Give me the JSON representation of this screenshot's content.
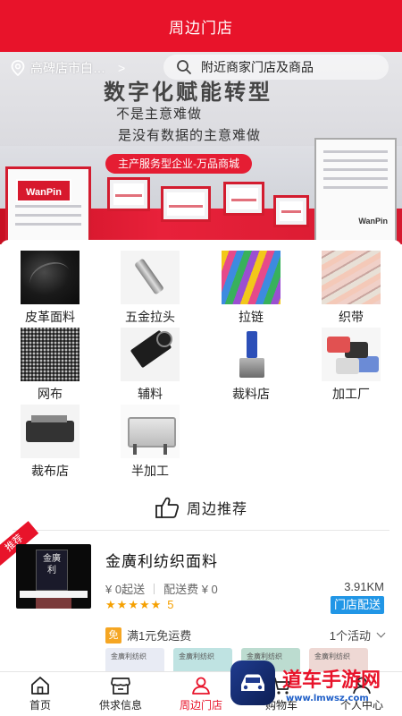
{
  "header": {
    "title": "周边门店"
  },
  "location": {
    "text": "高碑店市白…"
  },
  "search": {
    "placeholder": "附近商家门店及商品"
  },
  "banner": {
    "headline": "数字化赋能转型",
    "line1": "不是主意难做",
    "line2": "是没有数据的主意难做",
    "pill": "主产服务型企业-万品商城",
    "logo": "WanPin",
    "logo_small": "WanPin"
  },
  "categories": [
    {
      "label": "皮革面料",
      "icon": "leather-fabric-image"
    },
    {
      "label": "五金拉头",
      "icon": "zipper-head-image"
    },
    {
      "label": "拉链",
      "icon": "zipper-image"
    },
    {
      "label": "织带",
      "icon": "webbing-image"
    },
    {
      "label": "网布",
      "icon": "mesh-fabric-image"
    },
    {
      "label": "辅料",
      "icon": "accessories-image"
    },
    {
      "label": "裁料店",
      "icon": "cutting-shop-image"
    },
    {
      "label": "加工厂",
      "icon": "factory-image"
    },
    {
      "label": "裁布店",
      "icon": "cloth-cutting-image"
    },
    {
      "label": "半加工",
      "icon": "semi-processing-image"
    }
  ],
  "recommend": {
    "title": "周边推荐",
    "icon": "thumbs-up-icon"
  },
  "store": {
    "ribbon": "推荐",
    "thumb_text": "金廣利",
    "name": "金廣利纺织面料",
    "min_order": "¥ 0起送",
    "delivery_fee": "配送费 ¥ 0",
    "distance": "3.91KM",
    "rating": "5",
    "rating_stars": 5,
    "delivery_badge": "门店配送",
    "promo_badge": "免",
    "promo_text": "满1元免运费",
    "activity": "1个活动",
    "product_label": "金廣利纺织"
  },
  "tabbar": [
    {
      "label": "首页",
      "icon": "home-icon",
      "active": false
    },
    {
      "label": "供求信息",
      "icon": "store-icon",
      "active": false
    },
    {
      "label": "周边门店",
      "icon": "user-location-icon",
      "active": true
    },
    {
      "label": "购物车",
      "icon": "cart-icon",
      "active": false
    },
    {
      "label": "个人中心",
      "icon": "profile-icon",
      "active": false
    }
  ],
  "watermark": {
    "title": "道车手游网",
    "url": "www.lmwsz.com"
  },
  "colors": {
    "brand_red": "#e8132a",
    "delivery_blue": "#2196e6",
    "promo_orange": "#f5a623",
    "star_gold": "#f5a000"
  }
}
